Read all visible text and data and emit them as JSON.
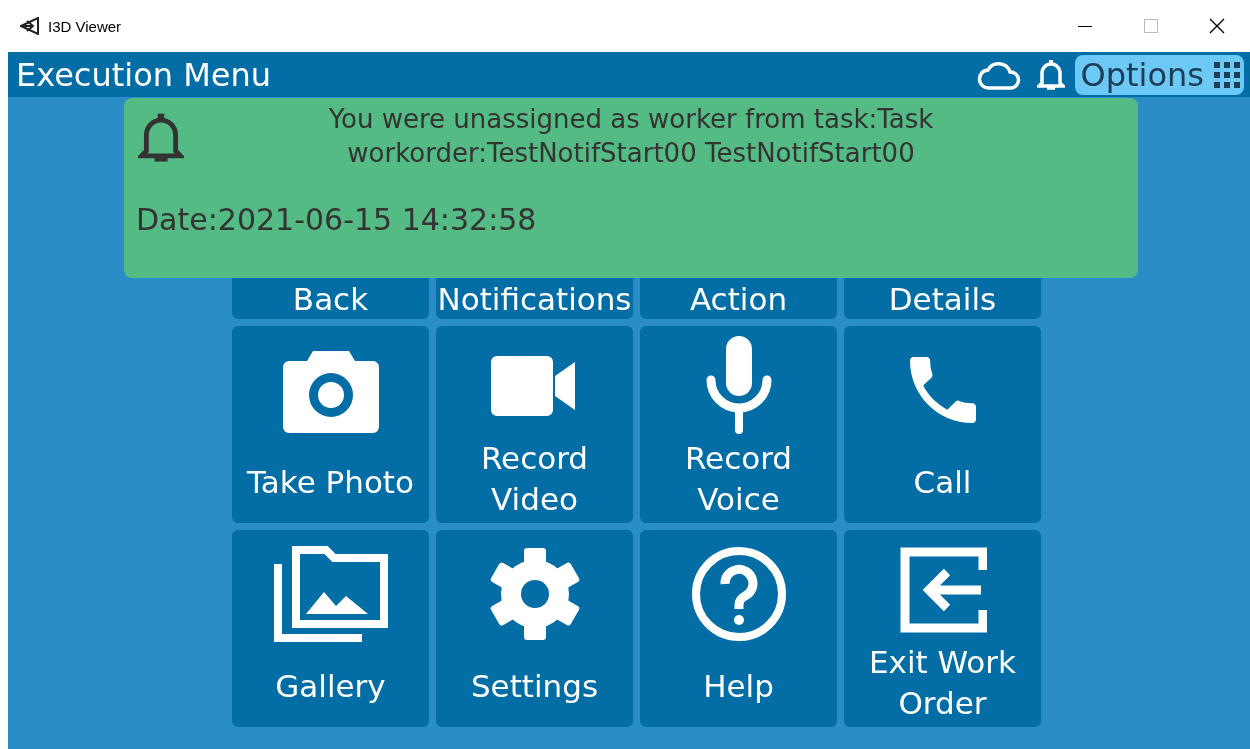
{
  "window": {
    "title": "I3D Viewer"
  },
  "header": {
    "title": "Execution Menu",
    "options_label": "Options"
  },
  "notification": {
    "message_lines": [
      "You were unassigned as worker from task:Task",
      "workorder:TestNotifStart00 TestNotifStart00"
    ],
    "date": "Date:2021-06-15 14:32:58"
  },
  "tiles": [
    {
      "label": "Back",
      "kind": "plain"
    },
    {
      "label": "Notifications",
      "kind": "plain"
    },
    {
      "label": "Action",
      "kind": "plain"
    },
    {
      "label": "Details",
      "kind": "plain"
    },
    {
      "label": "Take Photo",
      "kind": "camera"
    },
    {
      "label": "Record Video",
      "kind": "video"
    },
    {
      "label": "Record Voice",
      "kind": "microphone"
    },
    {
      "label": "Call",
      "kind": "phone"
    },
    {
      "label": "Gallery",
      "kind": "gallery"
    },
    {
      "label": "Settings",
      "kind": "settings"
    },
    {
      "label": "Help",
      "kind": "help"
    },
    {
      "label": "Exit Work Order",
      "kind": "exit"
    }
  ]
}
